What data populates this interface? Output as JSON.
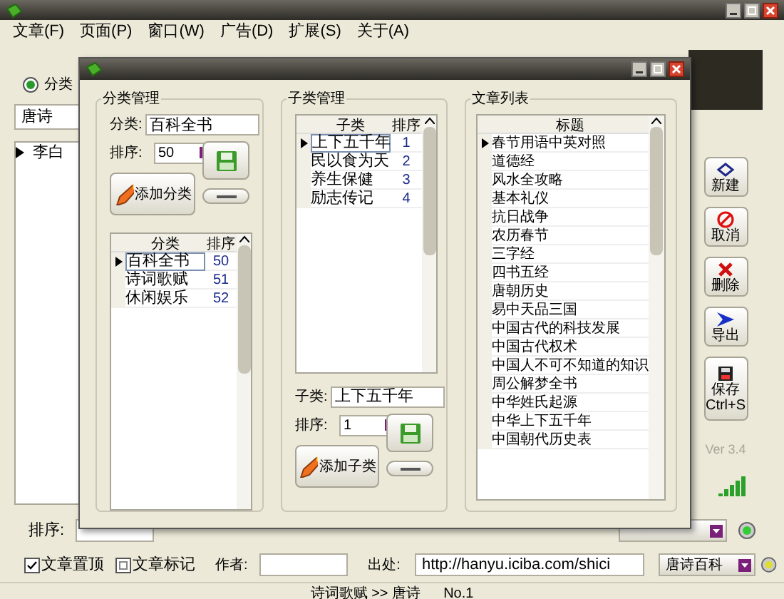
{
  "menu": [
    "文章(F)",
    "页面(P)",
    "窗口(W)",
    "广告(D)",
    "扩展(S)",
    "关于(A)"
  ],
  "filter": {
    "radio_label": "分类",
    "radio_selected": true,
    "category": "唐诗"
  },
  "article_list": [
    {
      "title": "李白",
      "selected": true
    }
  ],
  "side_buttons": [
    {
      "kind": "new",
      "label": "新建"
    },
    {
      "kind": "cancel",
      "label": "取消"
    },
    {
      "kind": "delete",
      "label": "删除"
    },
    {
      "kind": "export",
      "label": "导出"
    },
    {
      "kind": "save",
      "label": "保存\nCtrl+S"
    }
  ],
  "version": "Ver 3.4",
  "bottom": {
    "sort_label": "排序:",
    "pin": {
      "label": "文章置顶",
      "checked": true
    },
    "mark": {
      "label": "文章标记",
      "checked": false
    },
    "author_label": "作者:",
    "source_label": "出处:",
    "source_value": "http://hanyu.iciba.com/shici",
    "site": "唐诗百科"
  },
  "status_bar": {
    "path": "诗词歌赋 >> 唐诗",
    "number": "No.1"
  },
  "dialog": {
    "category_group": {
      "title": "分类管理",
      "name_label": "分类:",
      "name_value": "百科全书",
      "order_label": "排序:",
      "order_value": "50",
      "add_button": "添加分类",
      "columns": [
        "分类",
        "排序"
      ],
      "rows": [
        {
          "name": "百科全书",
          "order": "50",
          "selected": true
        },
        {
          "name": "诗词歌赋",
          "order": "51",
          "selected": false
        },
        {
          "name": "休闲娱乐",
          "order": "52",
          "selected": false
        }
      ]
    },
    "subcategory_group": {
      "title": "子类管理",
      "columns": [
        "子类",
        "排序"
      ],
      "rows": [
        {
          "name": "上下五千年",
          "order": "1",
          "selected": true
        },
        {
          "name": "民以食为天",
          "order": "2",
          "selected": false
        },
        {
          "name": "养生保健",
          "order": "3",
          "selected": false
        },
        {
          "name": "励志传记",
          "order": "4",
          "selected": false
        }
      ],
      "name_label": "子类:",
      "name_value": "上下五千年",
      "order_label": "排序:",
      "order_value": "1",
      "add_button": "添加子类"
    },
    "article_group": {
      "title": "文章列表",
      "column": "标题",
      "rows": [
        {
          "title": "春节用语中英对照",
          "selected": true
        },
        {
          "title": "道德经",
          "selected": false
        },
        {
          "title": "风水全攻略",
          "selected": false
        },
        {
          "title": "基本礼仪",
          "selected": false
        },
        {
          "title": "抗日战争",
          "selected": false
        },
        {
          "title": "农历春节",
          "selected": false
        },
        {
          "title": "三字经",
          "selected": false
        },
        {
          "title": "四书五经",
          "selected": false
        },
        {
          "title": "唐朝历史",
          "selected": false
        },
        {
          "title": "易中天品三国",
          "selected": false
        },
        {
          "title": "中国古代的科技发展",
          "selected": false
        },
        {
          "title": "中国古代权术",
          "selected": false
        },
        {
          "title": "中国人不可不知道的知识",
          "selected": false
        },
        {
          "title": "周公解梦全书",
          "selected": false
        },
        {
          "title": "中华姓氏起源",
          "selected": false
        },
        {
          "title": "中华上下五千年",
          "selected": false
        },
        {
          "title": "中国朝代历史表",
          "selected": false
        }
      ]
    }
  }
}
